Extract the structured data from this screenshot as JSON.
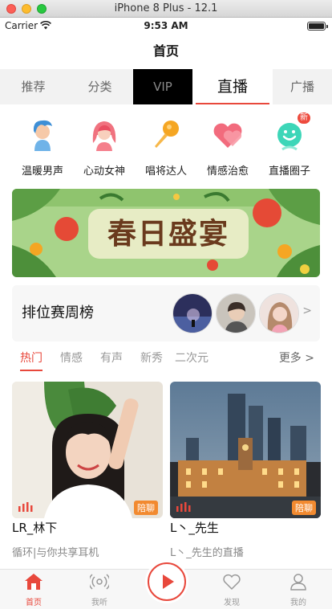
{
  "simulator": {
    "title": "iPhone 8 Plus - 12.1"
  },
  "status_bar": {
    "carrier": "Carrier",
    "time": "9:53 AM"
  },
  "nav": {
    "title": "首页"
  },
  "top_tabs": [
    {
      "label": "推荐"
    },
    {
      "label": "分类"
    },
    {
      "label": "VIP"
    },
    {
      "label": "直播",
      "active": true
    },
    {
      "label": "广播"
    }
  ],
  "categories": [
    {
      "label": "温暖男声",
      "icon": "male-avatar-icon"
    },
    {
      "label": "心动女神",
      "icon": "female-avatar-icon"
    },
    {
      "label": "唱将达人",
      "icon": "microphone-icon"
    },
    {
      "label": "情感治愈",
      "icon": "heart-icon"
    },
    {
      "label": "直播圈子",
      "icon": "smile-circle-icon",
      "badge": "新"
    }
  ],
  "banner": {
    "text": "春日盛宴"
  },
  "rank": {
    "title": "排位赛周榜",
    "arrow": ">"
  },
  "sub_tabs": [
    {
      "label": "热门",
      "active": true
    },
    {
      "label": "情感"
    },
    {
      "label": "有声"
    },
    {
      "label": "新秀"
    },
    {
      "label": "二次元"
    }
  ],
  "more": "更多 >",
  "cards": [
    {
      "title": "LR_林下",
      "subtitle": "循环|与你共享耳机",
      "tag": "陪聊"
    },
    {
      "title": "L丶_先生",
      "subtitle": "L丶_先生的直播",
      "tag": "陪聊"
    }
  ],
  "tabbar": [
    {
      "label": "首页",
      "active": true
    },
    {
      "label": "我听"
    },
    {
      "label": "发现"
    },
    {
      "label": "我的"
    }
  ],
  "colors": {
    "accent": "#e8483c",
    "tag": "#f28a30"
  }
}
